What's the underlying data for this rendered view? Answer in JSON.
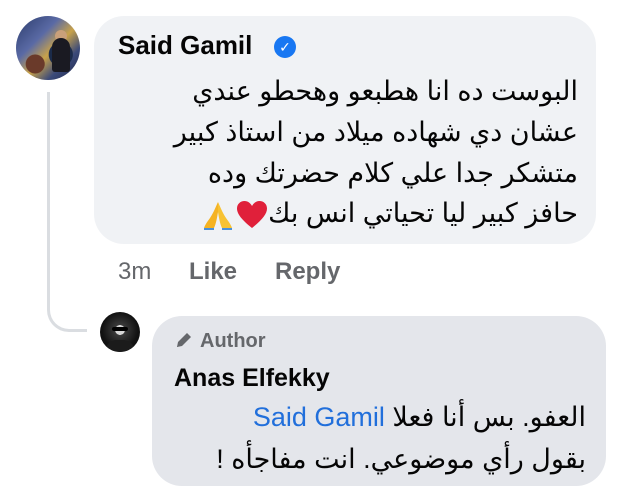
{
  "comment": {
    "author": "Said Gamil",
    "verified": true,
    "lines": [
      "البوست ده انا هطبعو وهحطو عندي",
      "عشان دي شهاده ميلاد من استاذ كبير",
      "متشكر جدا علي كلام حضرتك وده",
      "حافز كبير ليا تحياتي انس بك"
    ],
    "emojis": [
      "red-heart",
      "folded-hands"
    ],
    "time": "3m",
    "like_label": "Like",
    "reply_label": "Reply"
  },
  "reply": {
    "badge": "Author",
    "author": "Anas Elfekky",
    "mention": "Said Gamil",
    "line1_text": "العفو.  بس أنا فعلا",
    "line2_text": "بقول رأي موضوعي. انت مفاجأه !"
  },
  "colors": {
    "bubble_main": "#f0f2f5",
    "bubble_reply": "#e4e6eb",
    "verified_blue": "#1877f2",
    "mention_blue": "#216fdb",
    "meta_gray": "#65676b"
  }
}
